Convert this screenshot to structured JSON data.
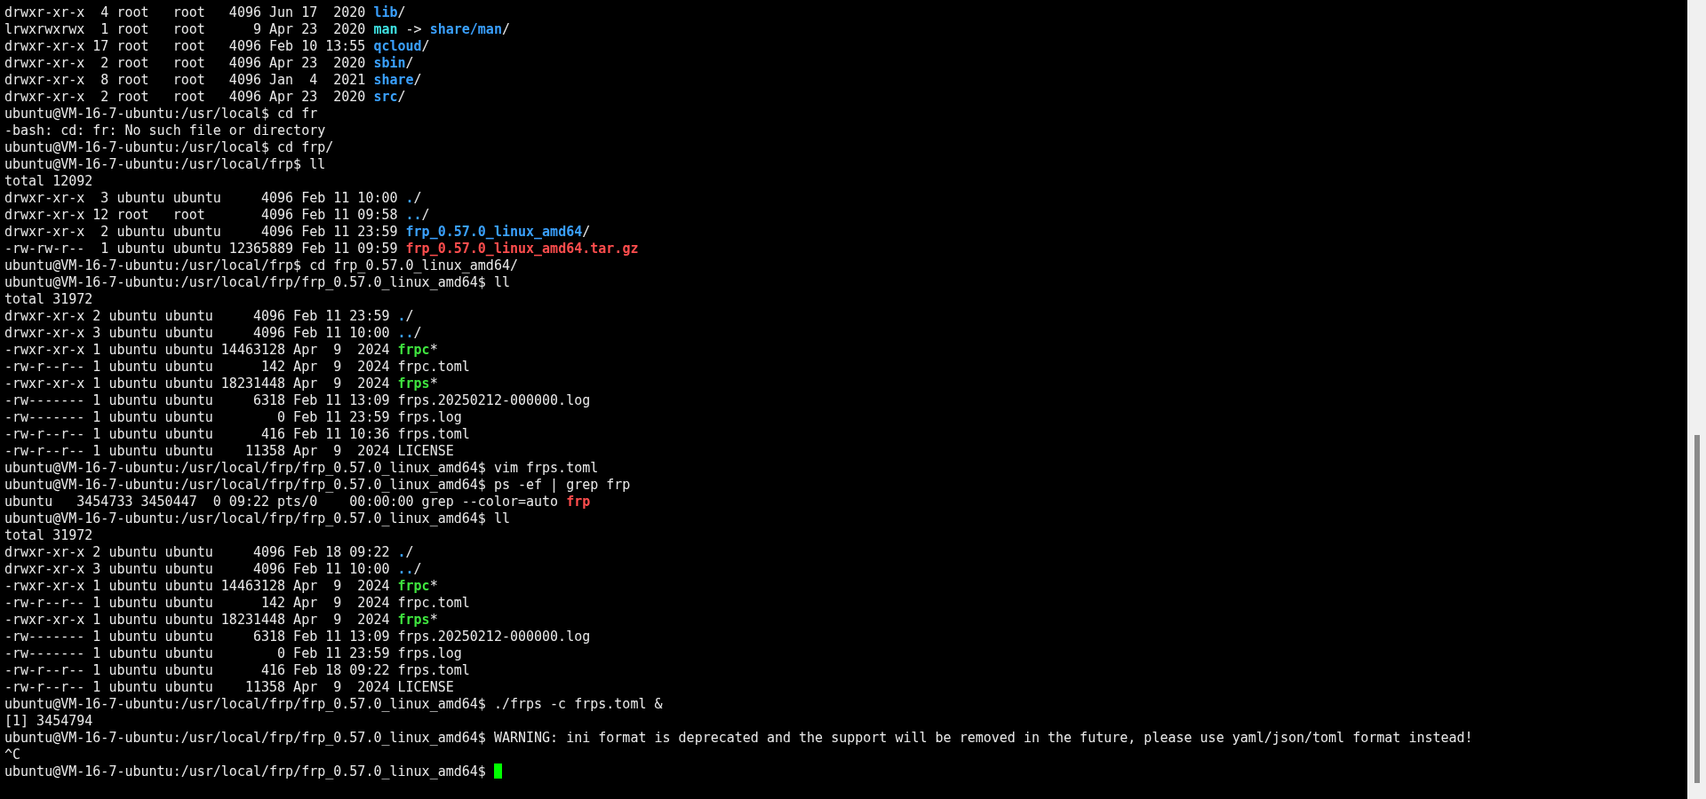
{
  "terminal": {
    "lines": [
      [
        {
          "text": "drwxr-xr-x  4 root   root   4096 Jun 17  2020 ",
          "kind": "plain"
        },
        {
          "text": "lib",
          "kind": "dir"
        },
        {
          "text": "/",
          "kind": "plain"
        }
      ],
      [
        {
          "text": "lrwxrwxrwx  1 root   root      9 Apr 23  2020 ",
          "kind": "plain"
        },
        {
          "text": "man",
          "kind": "link"
        },
        {
          "text": " -> ",
          "kind": "plain"
        },
        {
          "text": "share/man",
          "kind": "dir"
        },
        {
          "text": "/",
          "kind": "plain"
        }
      ],
      [
        {
          "text": "drwxr-xr-x 17 root   root   4096 Feb 10 13:55 ",
          "kind": "plain"
        },
        {
          "text": "qcloud",
          "kind": "dir"
        },
        {
          "text": "/",
          "kind": "plain"
        }
      ],
      [
        {
          "text": "drwxr-xr-x  2 root   root   4096 Apr 23  2020 ",
          "kind": "plain"
        },
        {
          "text": "sbin",
          "kind": "dir"
        },
        {
          "text": "/",
          "kind": "plain"
        }
      ],
      [
        {
          "text": "drwxr-xr-x  8 root   root   4096 Jan  4  2021 ",
          "kind": "plain"
        },
        {
          "text": "share",
          "kind": "dir"
        },
        {
          "text": "/",
          "kind": "plain"
        }
      ],
      [
        {
          "text": "drwxr-xr-x  2 root   root   4096 Apr 23  2020 ",
          "kind": "plain"
        },
        {
          "text": "src",
          "kind": "dir"
        },
        {
          "text": "/",
          "kind": "plain"
        }
      ],
      [
        {
          "text": "ubuntu@VM-16-7-ubuntu:/usr/local$ cd fr",
          "kind": "plain"
        }
      ],
      [
        {
          "text": "-bash: cd: fr: No such file or directory",
          "kind": "plain"
        }
      ],
      [
        {
          "text": "ubuntu@VM-16-7-ubuntu:/usr/local$ cd frp/",
          "kind": "plain"
        }
      ],
      [
        {
          "text": "ubuntu@VM-16-7-ubuntu:/usr/local/frp$ ll",
          "kind": "plain"
        }
      ],
      [
        {
          "text": "total 12092",
          "kind": "plain"
        }
      ],
      [
        {
          "text": "drwxr-xr-x  3 ubuntu ubuntu     4096 Feb 11 10:00 ",
          "kind": "plain"
        },
        {
          "text": ".",
          "kind": "dir"
        },
        {
          "text": "/",
          "kind": "plain"
        }
      ],
      [
        {
          "text": "drwxr-xr-x 12 root   root       4096 Feb 11 09:58 ",
          "kind": "plain"
        },
        {
          "text": "..",
          "kind": "dir"
        },
        {
          "text": "/",
          "kind": "plain"
        }
      ],
      [
        {
          "text": "drwxr-xr-x  2 ubuntu ubuntu     4096 Feb 11 23:59 ",
          "kind": "plain"
        },
        {
          "text": "frp_0.57.0_linux_amd64",
          "kind": "dir"
        },
        {
          "text": "/",
          "kind": "plain"
        }
      ],
      [
        {
          "text": "-rw-rw-r--  1 ubuntu ubuntu 12365889 Feb 11 09:59 ",
          "kind": "plain"
        },
        {
          "text": "frp_0.57.0_linux_amd64.tar.gz",
          "kind": "archive"
        }
      ],
      [
        {
          "text": "ubuntu@VM-16-7-ubuntu:/usr/local/frp$ cd frp_0.57.0_linux_amd64/",
          "kind": "plain"
        }
      ],
      [
        {
          "text": "ubuntu@VM-16-7-ubuntu:/usr/local/frp/frp_0.57.0_linux_amd64$ ll",
          "kind": "plain"
        }
      ],
      [
        {
          "text": "total 31972",
          "kind": "plain"
        }
      ],
      [
        {
          "text": "drwxr-xr-x 2 ubuntu ubuntu     4096 Feb 11 23:59 ",
          "kind": "plain"
        },
        {
          "text": ".",
          "kind": "dir"
        },
        {
          "text": "/",
          "kind": "plain"
        }
      ],
      [
        {
          "text": "drwxr-xr-x 3 ubuntu ubuntu     4096 Feb 11 10:00 ",
          "kind": "plain"
        },
        {
          "text": "..",
          "kind": "dir"
        },
        {
          "text": "/",
          "kind": "plain"
        }
      ],
      [
        {
          "text": "-rwxr-xr-x 1 ubuntu ubuntu 14463128 Apr  9  2024 ",
          "kind": "plain"
        },
        {
          "text": "frpc",
          "kind": "exec"
        },
        {
          "text": "*",
          "kind": "plain"
        }
      ],
      [
        {
          "text": "-rw-r--r-- 1 ubuntu ubuntu      142 Apr  9  2024 frpc.toml",
          "kind": "plain"
        }
      ],
      [
        {
          "text": "-rwxr-xr-x 1 ubuntu ubuntu 18231448 Apr  9  2024 ",
          "kind": "plain"
        },
        {
          "text": "frps",
          "kind": "exec"
        },
        {
          "text": "*",
          "kind": "plain"
        }
      ],
      [
        {
          "text": "-rw------- 1 ubuntu ubuntu     6318 Feb 11 13:09 frps.20250212-000000.log",
          "kind": "plain"
        }
      ],
      [
        {
          "text": "-rw------- 1 ubuntu ubuntu        0 Feb 11 23:59 frps.log",
          "kind": "plain"
        }
      ],
      [
        {
          "text": "-rw-r--r-- 1 ubuntu ubuntu      416 Feb 11 10:36 frps.toml",
          "kind": "plain"
        }
      ],
      [
        {
          "text": "-rw-r--r-- 1 ubuntu ubuntu    11358 Apr  9  2024 LICENSE",
          "kind": "plain"
        }
      ],
      [
        {
          "text": "ubuntu@VM-16-7-ubuntu:/usr/local/frp/frp_0.57.0_linux_amd64$ vim frps.toml",
          "kind": "plain"
        }
      ],
      [
        {
          "text": "ubuntu@VM-16-7-ubuntu:/usr/local/frp/frp_0.57.0_linux_amd64$ ps -ef | grep frp",
          "kind": "plain"
        }
      ],
      [
        {
          "text": "ubuntu   3454733 3450447  0 09:22 pts/0    00:00:00 grep --color=auto ",
          "kind": "plain"
        },
        {
          "text": "frp",
          "kind": "match"
        }
      ],
      [
        {
          "text": "ubuntu@VM-16-7-ubuntu:/usr/local/frp/frp_0.57.0_linux_amd64$ ll",
          "kind": "plain"
        }
      ],
      [
        {
          "text": "total 31972",
          "kind": "plain"
        }
      ],
      [
        {
          "text": "drwxr-xr-x 2 ubuntu ubuntu     4096 Feb 18 09:22 ",
          "kind": "plain"
        },
        {
          "text": ".",
          "kind": "dir"
        },
        {
          "text": "/",
          "kind": "plain"
        }
      ],
      [
        {
          "text": "drwxr-xr-x 3 ubuntu ubuntu     4096 Feb 11 10:00 ",
          "kind": "plain"
        },
        {
          "text": "..",
          "kind": "dir"
        },
        {
          "text": "/",
          "kind": "plain"
        }
      ],
      [
        {
          "text": "-rwxr-xr-x 1 ubuntu ubuntu 14463128 Apr  9  2024 ",
          "kind": "plain"
        },
        {
          "text": "frpc",
          "kind": "exec"
        },
        {
          "text": "*",
          "kind": "plain"
        }
      ],
      [
        {
          "text": "-rw-r--r-- 1 ubuntu ubuntu      142 Apr  9  2024 frpc.toml",
          "kind": "plain"
        }
      ],
      [
        {
          "text": "-rwxr-xr-x 1 ubuntu ubuntu 18231448 Apr  9  2024 ",
          "kind": "plain"
        },
        {
          "text": "frps",
          "kind": "exec"
        },
        {
          "text": "*",
          "kind": "plain"
        }
      ],
      [
        {
          "text": "-rw------- 1 ubuntu ubuntu     6318 Feb 11 13:09 frps.20250212-000000.log",
          "kind": "plain"
        }
      ],
      [
        {
          "text": "-rw------- 1 ubuntu ubuntu        0 Feb 11 23:59 frps.log",
          "kind": "plain"
        }
      ],
      [
        {
          "text": "-rw-r--r-- 1 ubuntu ubuntu      416 Feb 18 09:22 frps.toml",
          "kind": "plain"
        }
      ],
      [
        {
          "text": "-rw-r--r-- 1 ubuntu ubuntu    11358 Apr  9  2024 LICENSE",
          "kind": "plain"
        }
      ],
      [
        {
          "text": "ubuntu@VM-16-7-ubuntu:/usr/local/frp/frp_0.57.0_linux_amd64$ ./frps -c frps.toml &",
          "kind": "plain"
        }
      ],
      [
        {
          "text": "[1] 3454794",
          "kind": "plain"
        }
      ],
      [
        {
          "text": "ubuntu@VM-16-7-ubuntu:/usr/local/frp/frp_0.57.0_linux_amd64$ WARNING: ini format is deprecated and the support will be removed in the future, please use yaml/json/toml format instead!",
          "kind": "plain"
        }
      ],
      [
        {
          "text": "^C",
          "kind": "plain"
        }
      ],
      [
        {
          "text": "ubuntu@VM-16-7-ubuntu:/usr/local/frp/frp_0.57.0_linux_amd64$ ",
          "kind": "plain"
        }
      ]
    ],
    "cursor": true
  }
}
